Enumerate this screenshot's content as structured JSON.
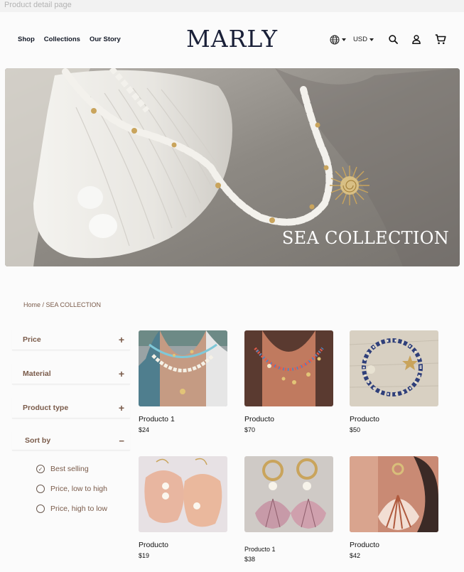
{
  "frame": {
    "label": "Product detail page",
    "check": "✓"
  },
  "header": {
    "nav": [
      "Shop",
      "Collections",
      "Our Story"
    ],
    "logo": "MARLY",
    "currency": "USD",
    "icons": [
      "globe-icon",
      "search-icon",
      "user-icon",
      "cart-icon"
    ]
  },
  "hero": {
    "title": "SEA COLLECTION"
  },
  "breadcrumb": {
    "home": "Home",
    "separator": " / ",
    "current": "SEA COLLECTION"
  },
  "filters": [
    {
      "label": "Price",
      "state": "+"
    },
    {
      "label": "Material",
      "state": "+"
    },
    {
      "label": "Product type",
      "state": "+"
    }
  ],
  "sort": {
    "label": "Sort by",
    "state": "−",
    "options": [
      {
        "label": "Best selling",
        "selected": true
      },
      {
        "label": "Price, low to high",
        "selected": false
      },
      {
        "label": "Price, high to low",
        "selected": false
      }
    ]
  },
  "products": [
    {
      "name": "Producto 1",
      "price": "$24"
    },
    {
      "name": "Producto",
      "price": "$70"
    },
    {
      "name": "Producto",
      "price": "$50"
    },
    {
      "name": "Producto",
      "price": "$19"
    },
    {
      "name": "Producto 1",
      "price": "$38"
    },
    {
      "name": "Producto",
      "price": "$42"
    }
  ],
  "colors": {
    "accent_brown": "#7a5b4a",
    "logo_navy": "#1a2038"
  }
}
